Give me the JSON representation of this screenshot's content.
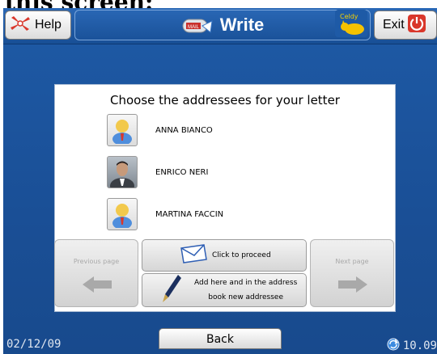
{
  "heading_crop": "this screen:",
  "topbar": {
    "help_label": "Help",
    "title": "Write",
    "exit_label": "Exit"
  },
  "panel": {
    "title": "Choose the addressees for your letter",
    "contacts": [
      {
        "name": "ANNA BIANCO",
        "avatar": "generic-user-icon"
      },
      {
        "name": "ENRICO NERI",
        "avatar": "photo"
      },
      {
        "name": "MARTINA FACCIN",
        "avatar": "generic-user-icon"
      }
    ]
  },
  "controls": {
    "previous_label": "Previous page",
    "next_label": "Next page",
    "proceed_label": "Click to proceed",
    "add_label_line1": "Add here and in the address",
    "add_label_line2": "book new addressee"
  },
  "footer": {
    "date": "02/12/09",
    "back_label": "Back",
    "time": "10.09"
  },
  "colors": {
    "background": "#1a4f96",
    "panel": "#ffffff",
    "accent_red": "#d9372b"
  }
}
